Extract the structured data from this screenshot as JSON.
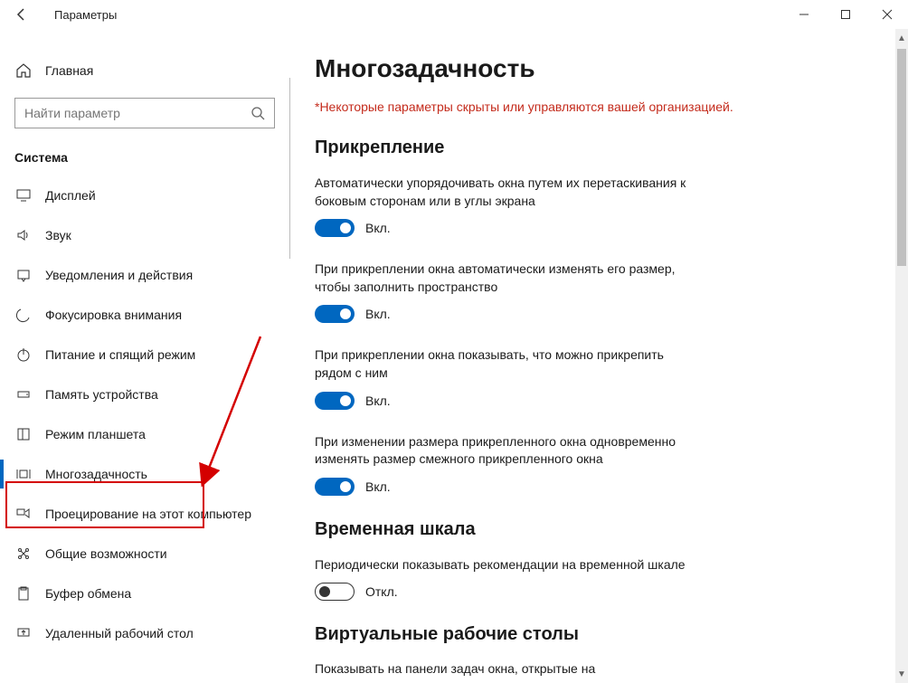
{
  "window": {
    "title": "Параметры"
  },
  "sidebar": {
    "home_label": "Главная",
    "search_placeholder": "Найти параметр",
    "section_label": "Система",
    "items": [
      {
        "label": "Дисплей",
        "icon": "display-icon"
      },
      {
        "label": "Звук",
        "icon": "sound-icon"
      },
      {
        "label": "Уведомления и действия",
        "icon": "notifications-icon"
      },
      {
        "label": "Фокусировка внимания",
        "icon": "focus-icon"
      },
      {
        "label": "Питание и спящий режим",
        "icon": "power-icon"
      },
      {
        "label": "Память устройства",
        "icon": "storage-icon"
      },
      {
        "label": "Режим планшета",
        "icon": "tablet-icon"
      },
      {
        "label": "Многозадачность",
        "icon": "multitask-icon",
        "active": true
      },
      {
        "label": "Проецирование на этот компьютер",
        "icon": "project-icon"
      },
      {
        "label": "Общие возможности",
        "icon": "shared-icon"
      },
      {
        "label": "Буфер обмена",
        "icon": "clipboard-icon"
      },
      {
        "label": "Удаленный рабочий стол",
        "icon": "remote-icon"
      }
    ]
  },
  "main": {
    "heading": "Многозадачность",
    "warning": "*Некоторые параметры скрыты или управляются вашей организацией.",
    "snap_heading": "Прикрепление",
    "settings": [
      {
        "desc": "Автоматически упорядочивать окна путем их перетаскивания к боковым сторонам или в углы экрана",
        "state": "on",
        "state_label": "Вкл."
      },
      {
        "desc": "При прикреплении окна автоматически изменять его размер, чтобы заполнить пространство",
        "state": "on",
        "state_label": "Вкл."
      },
      {
        "desc": "При прикреплении окна показывать, что можно прикрепить рядом с ним",
        "state": "on",
        "state_label": "Вкл."
      },
      {
        "desc": "При изменении размера прикрепленного окна одновременно изменять размер смежного прикрепленного окна",
        "state": "on",
        "state_label": "Вкл."
      }
    ],
    "timeline_heading": "Временная шкала",
    "timeline_setting": {
      "desc": "Периодически показывать рекомендации на временной шкале",
      "state": "off",
      "state_label": "Откл."
    },
    "vdesk_heading": "Виртуальные рабочие столы",
    "vdesk_desc": "Показывать на панели задач окна, открытые на"
  }
}
